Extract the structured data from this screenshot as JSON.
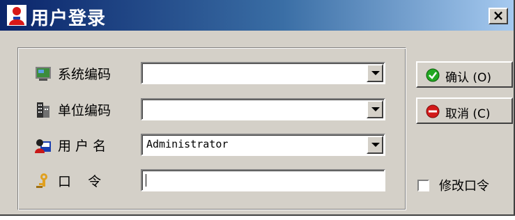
{
  "window": {
    "title": "用户登录",
    "close_label": "×"
  },
  "form": {
    "system_code": {
      "label": "系统编码",
      "value": ""
    },
    "unit_code": {
      "label": "单位编码",
      "value": ""
    },
    "username": {
      "label": "用 户 名",
      "value": "Administrator"
    },
    "password": {
      "label": "口    令",
      "value": ""
    }
  },
  "buttons": {
    "confirm_label": "确认 (O)",
    "cancel_label": "取消 (C)"
  },
  "change_password": {
    "label": "修改口令",
    "checked": false
  },
  "colors": {
    "window_bg": "#d4d0c8",
    "titlebar_start": "#0a246a",
    "titlebar_end": "#a6caf0",
    "confirm_icon": "#22a822",
    "cancel_icon": "#d21a1a"
  },
  "icons": {
    "title": "user-icon",
    "system_code": "monitor-icon",
    "unit_code": "building-icon",
    "username": "user-card-icon",
    "password": "key-icon",
    "confirm": "check-circle-icon",
    "cancel": "no-entry-icon"
  }
}
